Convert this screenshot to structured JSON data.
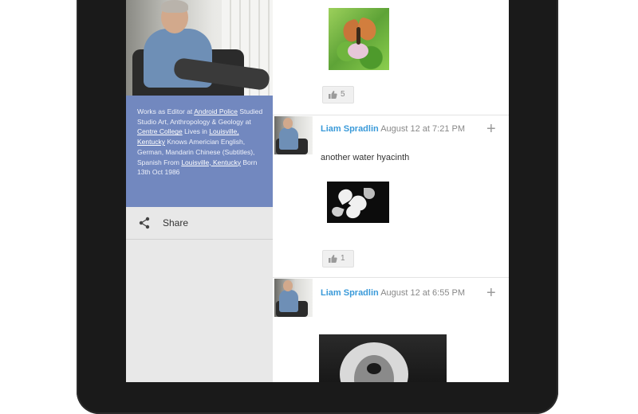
{
  "profile": {
    "bio": {
      "line1_prefix": "Works as Editor at",
      "workplace": "Android Police",
      "line2_prefix": "Studied Studio Art, Anthropology & Geology at",
      "school": "Centre College",
      "lives_prefix": "Lives in",
      "lives": "Louisville, Kentucky",
      "languages": "Knows Americian English, German, Mandarin Chinese (Subtitles), Spanish",
      "from_prefix": "From",
      "from": "Louisville, Kentucky",
      "born": "Born 13th Oct 1986"
    },
    "share_label": "Share"
  },
  "posts": [
    {
      "plus_count": "5"
    },
    {
      "author": "Liam Spradlin",
      "time": "August 12 at 7:21 PM",
      "text": "another water hyacinth",
      "plus_count": "1"
    },
    {
      "author": "Liam Spradlin",
      "time": "August 12 at 6:55 PM"
    }
  ],
  "icons": {
    "share": "share-icon",
    "plus_one": "thumb-up-icon",
    "add": "plus-icon"
  },
  "colors": {
    "bio_bg": "#7288bf",
    "author": "#3a9ad9",
    "bezel": "#1a1a1a"
  }
}
